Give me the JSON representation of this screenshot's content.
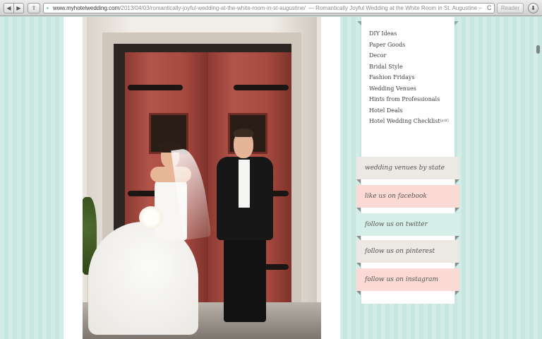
{
  "browser": {
    "url_host": "www.myhotelwedding.com",
    "url_path": "/2013/04/03/romantically-joyful-wedding-at-the-white-room-in-st-augustine/",
    "page_title": "— Romantically Joyful Wedding at the White Room in St. Augustine –",
    "reader_label": "Reader",
    "back_icon": "◀",
    "forward_icon": "▶",
    "share_icon": "⇪",
    "reload_icon": "C",
    "download_icon": "⬇"
  },
  "sidebar": {
    "nav_items": [
      {
        "label": "DIY Ideas"
      },
      {
        "label": "Paper Goods"
      },
      {
        "label": "Decor"
      },
      {
        "label": "Bridal Style"
      },
      {
        "label": "Fashion Fridays"
      },
      {
        "label": "Wedding Venues"
      },
      {
        "label": "Hints from Professionals"
      },
      {
        "label": "Hotel Deals"
      },
      {
        "label": "Hotel Wedding Checklist",
        "badge": "[pdf]"
      }
    ]
  },
  "social": {
    "venues_by_state": "wedding venues by state",
    "facebook": "like us on facebook",
    "twitter": "follow us on twitter",
    "pinterest": "follow us on pinterest",
    "instagram": "follow us on instagram"
  },
  "colors": {
    "ribbon_gray": "#ece8e4",
    "ribbon_pink": "#fbdad5",
    "ribbon_mint": "#d6efe8",
    "ribbon_text": "#555555"
  }
}
